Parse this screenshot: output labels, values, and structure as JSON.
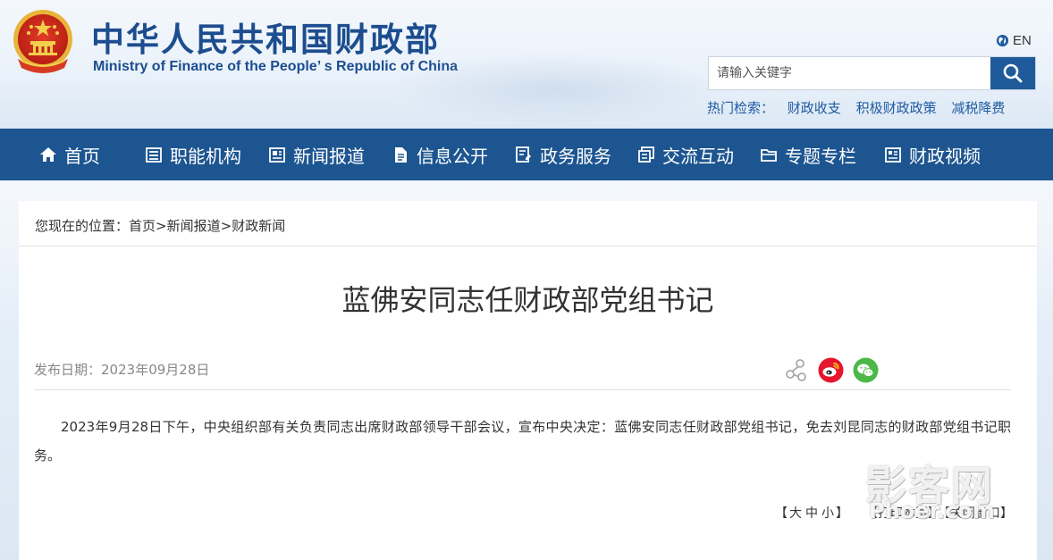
{
  "header": {
    "title_cn": "中华人民共和国财政部",
    "title_en": "Ministry of Finance of the People’ s Republic of China",
    "lang_link": "EN",
    "search_placeholder": "请输入关键字",
    "hot_label": "热门检索：",
    "hot_terms": [
      "财政收支",
      "积极财政政策",
      "减税降费"
    ]
  },
  "nav": {
    "items": [
      {
        "label": "首页",
        "icon": "home-icon"
      },
      {
        "label": "职能机构",
        "icon": "list-icon"
      },
      {
        "label": "新闻报道",
        "icon": "newspaper-icon"
      },
      {
        "label": "信息公开",
        "icon": "document-icon"
      },
      {
        "label": "政务服务",
        "icon": "service-icon"
      },
      {
        "label": "交流互动",
        "icon": "chat-icon"
      },
      {
        "label": "专题专栏",
        "icon": "folder-icon"
      },
      {
        "label": "财政视频",
        "icon": "video-icon"
      }
    ]
  },
  "breadcrumb": {
    "label": "您现在的位置：",
    "items": [
      "首页",
      "新闻报道",
      "财政新闻"
    ],
    "separator": ">"
  },
  "article": {
    "title": "蓝佛安同志任财政部党组书记",
    "date_label": "发布日期：",
    "date": "2023年09月28日",
    "body": "2023年9月28日下午，中央组织部有关负责同志出席财政部领导干部会议，宣布中央决定：蓝佛安同志任财政部党组书记，免去刘昆同志的财政部党组书记职务。"
  },
  "share": {
    "icons": [
      "share-icon",
      "weibo-icon",
      "wechat-icon"
    ],
    "colors": {
      "weibo": "#e6162d",
      "wechat": "#4cb848"
    }
  },
  "footer_tools": {
    "font_open": "【",
    "font_large": "大",
    "font_medium": "中",
    "font_small": "小",
    "font_close": "】",
    "print_label": "【打印本页】",
    "close_label": "【关闭窗口】"
  },
  "watermark": {
    "cn": "影客网",
    "en": "Phoer.com"
  },
  "colors": {
    "nav_bg": "#1d5590",
    "title_blue": "#1c4d8f",
    "link_blue": "#1e5aa0"
  }
}
